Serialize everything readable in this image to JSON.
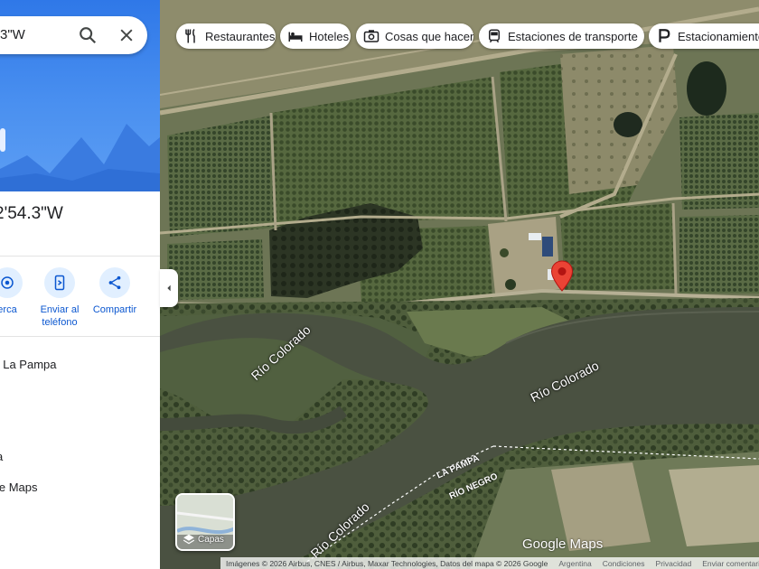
{
  "search": {
    "query": "3\"W"
  },
  "place": {
    "coordinates": "2'54.3\"W",
    "address_line": ", La Pampa",
    "line2": "a",
    "line3": "le Maps"
  },
  "actions": [
    {
      "label": "erca",
      "icon": "nearby-icon"
    },
    {
      "label": "Enviar al teléfono",
      "icon": "send-to-phone-icon"
    },
    {
      "label": "Compartir",
      "icon": "share-icon"
    }
  ],
  "chips": [
    {
      "label": "Restaurantes",
      "icon": "restaurant-icon"
    },
    {
      "label": "Hoteles",
      "icon": "hotel-icon"
    },
    {
      "label": "Cosas que hacer",
      "icon": "camera-icon"
    },
    {
      "label": "Estaciones de transporte",
      "icon": "transit-icon"
    },
    {
      "label": "Estacionamientos",
      "icon": "parking-icon"
    }
  ],
  "map": {
    "river_labels": [
      "Río Colorado",
      "Río Colorado",
      "Río Colorado"
    ],
    "province_labels": [
      "LA PAMPA",
      "RÍO NEGRO"
    ],
    "layers_label": "Capas",
    "logo": "Google Maps"
  },
  "footer": {
    "imagery": "Imágenes © 2026 Airbus, CNES / Airbus, Maxar Technologies, Datos del mapa © 2026 Google",
    "country": "Argentina",
    "terms": "Condiciones",
    "privacy": "Privacidad",
    "feedback": "Enviar comentarios"
  },
  "colors": {
    "pin": "#ea4335",
    "accent": "#0b57d0",
    "hero": "#4a90f0"
  }
}
